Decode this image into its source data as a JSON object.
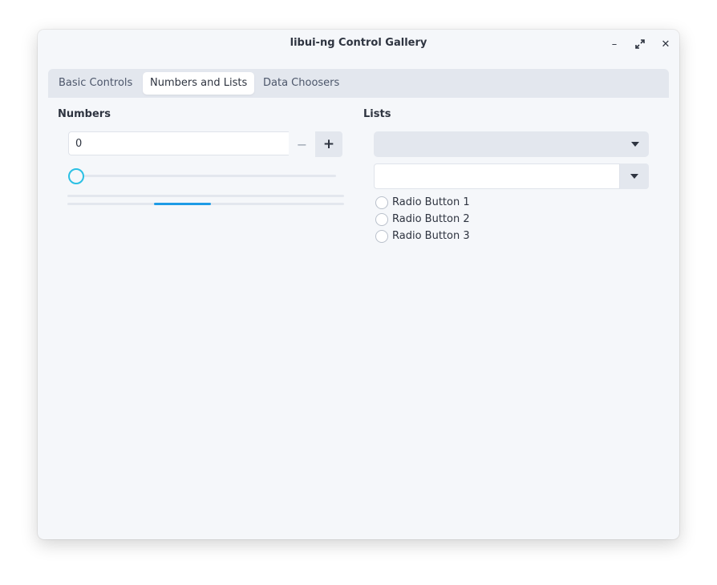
{
  "window": {
    "title": "libui-ng Control Gallery",
    "controls": {
      "minimize_icon": "–",
      "maximize_icon": "⤢",
      "close_icon": "✕"
    }
  },
  "tabs": [
    {
      "label": "Basic Controls",
      "active": false
    },
    {
      "label": "Numbers and Lists",
      "active": true
    },
    {
      "label": "Data Choosers",
      "active": false
    }
  ],
  "numbers": {
    "heading": "Numbers",
    "spinbox": {
      "value": "0",
      "minus_icon": "−",
      "plus_icon": "+"
    },
    "slider": {
      "value": 0,
      "accent": "#2bc0e4"
    },
    "progress_bars": [
      {
        "value": 0
      },
      {
        "indeterminate": true,
        "color": "#1e9be6"
      }
    ]
  },
  "lists": {
    "heading": "Lists",
    "combobox": {
      "selected": ""
    },
    "editable_combobox": {
      "value": ""
    },
    "radio_buttons": [
      {
        "label": "Radio Button 1",
        "checked": false
      },
      {
        "label": "Radio Button 2",
        "checked": false
      },
      {
        "label": "Radio Button 3",
        "checked": false
      }
    ]
  }
}
